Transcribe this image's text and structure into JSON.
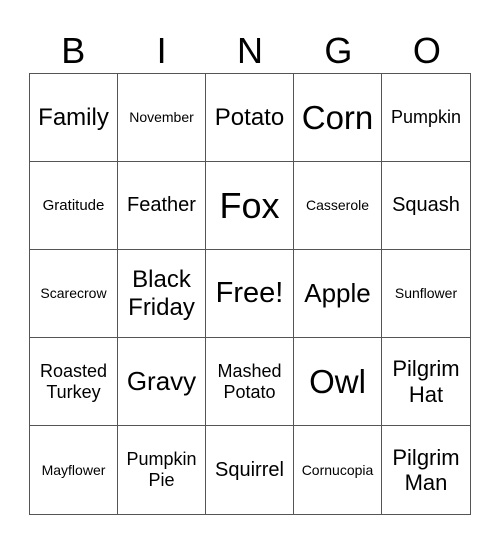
{
  "header": [
    "B",
    "I",
    "N",
    "G",
    "O"
  ],
  "cells": [
    {
      "text": "Family",
      "size": "s24"
    },
    {
      "text": "November",
      "size": "s14"
    },
    {
      "text": "Potato",
      "size": "s24"
    },
    {
      "text": "Corn",
      "size": "s33"
    },
    {
      "text": "Pumpkin",
      "size": "s18"
    },
    {
      "text": "Gratitude",
      "size": "s15"
    },
    {
      "text": "Feather",
      "size": "s20"
    },
    {
      "text": "Fox",
      "size": "s36"
    },
    {
      "text": "Casserole",
      "size": "s14"
    },
    {
      "text": "Squash",
      "size": "s20"
    },
    {
      "text": "Scarecrow",
      "size": "s14"
    },
    {
      "text": "Black Friday",
      "size": "s24"
    },
    {
      "text": "Free!",
      "size": "s29"
    },
    {
      "text": "Apple",
      "size": "s26"
    },
    {
      "text": "Sunflower",
      "size": "s14"
    },
    {
      "text": "Roasted Turkey",
      "size": "s18"
    },
    {
      "text": "Gravy",
      "size": "s26"
    },
    {
      "text": "Mashed Potato",
      "size": "s18"
    },
    {
      "text": "Owl",
      "size": "s33"
    },
    {
      "text": "Pilgrim Hat",
      "size": "s22"
    },
    {
      "text": "Mayflower",
      "size": "s14"
    },
    {
      "text": "Pumpkin Pie",
      "size": "s18"
    },
    {
      "text": "Squirrel",
      "size": "s20"
    },
    {
      "text": "Cornucopia",
      "size": "s14"
    },
    {
      "text": "Pilgrim Man",
      "size": "s22"
    }
  ]
}
